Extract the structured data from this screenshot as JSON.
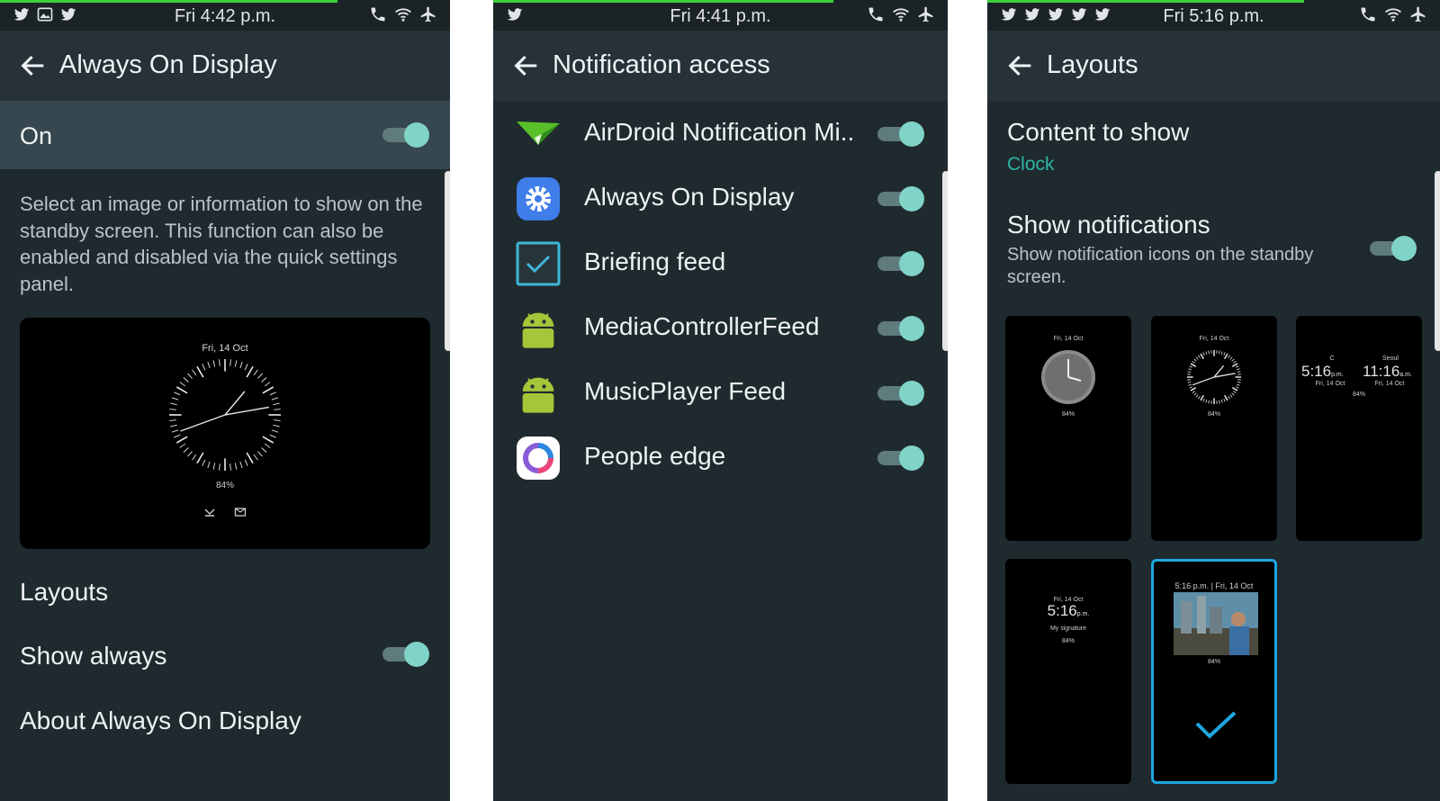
{
  "screens": {
    "always_on_display": {
      "status_time": "Fri 4:42 p.m.",
      "title": "Always On Display",
      "on_label": "On",
      "description": "Select an image or information to show on the standby screen. This function can also be enabled and disabled via the quick settings panel.",
      "preview": {
        "date": "Fri, 14 Oct",
        "battery": "84%"
      },
      "items": {
        "layouts": "Layouts",
        "show_always": "Show always",
        "about": "About Always On Display"
      }
    },
    "notification_access": {
      "status_time": "Fri 4:41 p.m.",
      "title": "Notification access",
      "apps": [
        {
          "name": "AirDroid Notification Mi..",
          "icon": "paper-plane-icon",
          "enabled": true
        },
        {
          "name": "Always On Display",
          "icon": "gear-icon",
          "enabled": true
        },
        {
          "name": "Briefing feed",
          "icon": "checkbox-icon",
          "enabled": true
        },
        {
          "name": "MediaControllerFeed",
          "icon": "android-icon",
          "enabled": true
        },
        {
          "name": "MusicPlayer Feed",
          "icon": "android-icon",
          "enabled": true
        },
        {
          "name": "People edge",
          "icon": "people-edge-icon",
          "enabled": true
        }
      ]
    },
    "layouts": {
      "status_time": "Fri 5:16 p.m.",
      "title": "Layouts",
      "content_to_show": {
        "title": "Content to show",
        "value": "Clock"
      },
      "show_notifications": {
        "title": "Show notifications",
        "description": "Show notification icons on the standby screen."
      },
      "thumbnails": {
        "t1": {
          "date": "Fri, 14 Oct",
          "battery": "84%"
        },
        "t2": {
          "date": "Fri, 14 Oct",
          "battery": "84%"
        },
        "t3": {
          "time_left": "5:16",
          "ampm_left": "p.m.",
          "time_right": "11:16",
          "ampm_right": "a.m.",
          "city_left": "C",
          "city_right": "Seoul",
          "date_left": "Fri, 14 Oct",
          "date_right": "Fri, 14 Oct",
          "battery": "84%"
        },
        "t4": {
          "date": "Fri, 14 Oct",
          "time": "5:16",
          "ampm": "p.m.",
          "signature": "My signature",
          "battery": "84%"
        },
        "t5": {
          "header": "5:16 p.m. | Fri, 14 Oct",
          "battery": "84%"
        }
      },
      "selected_layout": 5
    }
  },
  "colors": {
    "background": "#1f2a2f",
    "appbar": "#263238",
    "accent": "#2bb6a3",
    "toggle_thumb": "#7fd4c7",
    "selection": "#1da6e0"
  }
}
